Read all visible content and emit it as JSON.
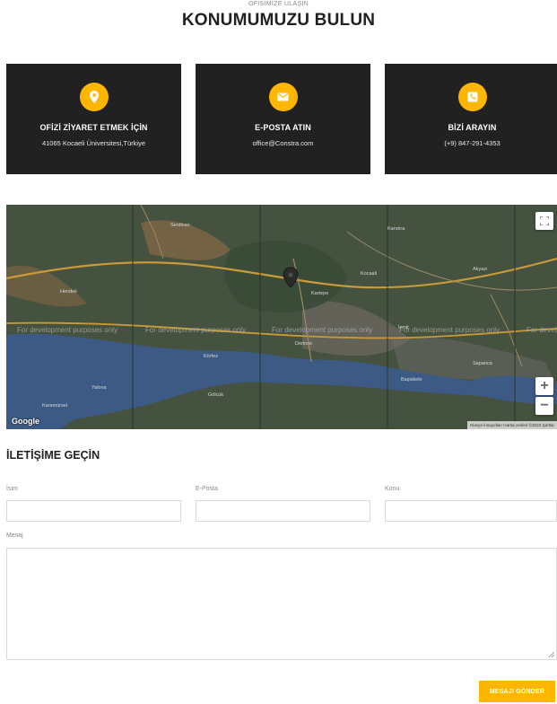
{
  "header": {
    "subtitle": "OFİSİMİZE ULAŞIN",
    "title": "KONUMUMUZU BULUN"
  },
  "cards": [
    {
      "icon": "location-pin-icon",
      "title": "OFİZİ ZİYARET ETMEK İÇİN",
      "text": "41065 Kocaeli Üniversitesi,Türkiye"
    },
    {
      "icon": "envelope-icon",
      "title": "E-POSTA ATIN",
      "text": "office@Constra.com"
    },
    {
      "icon": "phone-icon",
      "title": "BİZİ ARAYIN",
      "text": "(+9) 847-291-4353"
    }
  ],
  "map": {
    "dev_watermark": "For development purposes only",
    "google_logo": "Google",
    "attribution": "Klavye kısayolları   Harita verileri ©2023   Şartlar",
    "zoom_in": "+",
    "zoom_out": "−",
    "place_labels": {
      "serdivan": "Serdivan",
      "hendek": "Hendek",
      "kocaali": "Kocaali",
      "golcuk": "Gölcük",
      "kartepe": "Kartepe",
      "izmit": "İzmit",
      "derince": "Derince",
      "korfez": "Körfez",
      "basiskele": "Başiskele",
      "karamursel": "Karamürsel",
      "sapanca": "Sapanca",
      "akyazi": "Akyazı",
      "kandira": "Kandıra",
      "yalova": "Yalova"
    }
  },
  "contact": {
    "section_title": "İLETİŞİME GEÇİN",
    "name_label": "İsim",
    "email_label": "E-Posta",
    "subject_label": "Konu",
    "message_label": "Mesaj",
    "submit_label": "MESAJI GÖNDER"
  },
  "colors": {
    "accent": "#ffb600",
    "card_bg": "#212121"
  }
}
